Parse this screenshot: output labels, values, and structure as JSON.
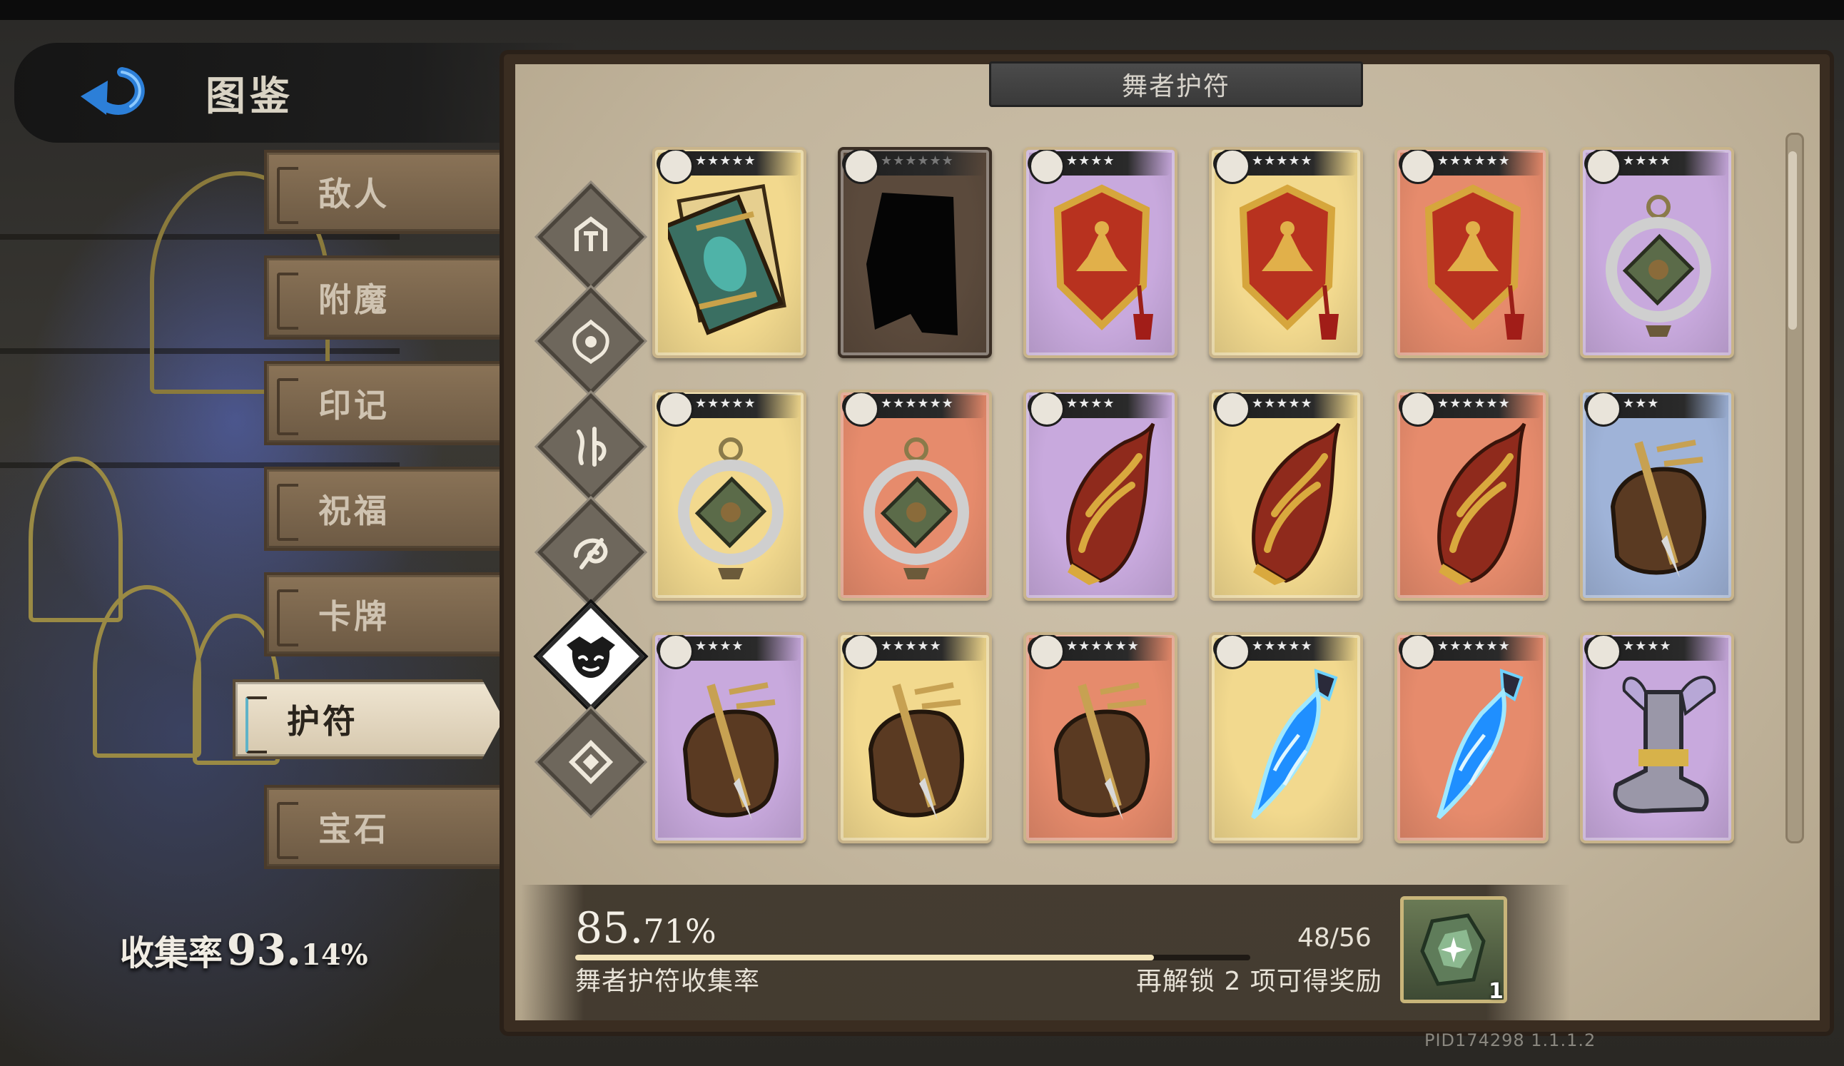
{
  "header": {
    "title": "图鉴",
    "back_icon": "back-arrow-icon"
  },
  "tabs": [
    {
      "label": "敌人",
      "active": false
    },
    {
      "label": "附魔",
      "active": false
    },
    {
      "label": "印记",
      "active": false
    },
    {
      "label": "祝福",
      "active": false
    },
    {
      "label": "卡牌",
      "active": false
    },
    {
      "label": "护符",
      "active": true
    },
    {
      "label": "宝石",
      "active": false
    }
  ],
  "collection": {
    "label": "收集率",
    "value_big": "93.",
    "value_small": "14%"
  },
  "panel": {
    "title": "舞者护符"
  },
  "categories": [
    {
      "icon": "warrior-helm-icon",
      "active": false
    },
    {
      "icon": "ornate-crest-icon",
      "active": false
    },
    {
      "icon": "rune-glyph-icon",
      "active": false
    },
    {
      "icon": "swirl-glyph-icon",
      "active": false
    },
    {
      "icon": "jester-mask-icon",
      "active": true
    },
    {
      "icon": "knot-emblem-icon",
      "active": false
    }
  ],
  "cards": [
    {
      "item": "spellbook",
      "bg": "#f2d98e",
      "stars": "★★★★★"
    },
    {
      "item": "unknown-silhouette",
      "bg": "#5b4a3c",
      "stars": "★★★★★★",
      "locked": true
    },
    {
      "item": "red-shield-charm",
      "bg": "#c8a9dd",
      "stars": "★★★★"
    },
    {
      "item": "red-shield-charm",
      "bg": "#f2d98e",
      "stars": "★★★★★"
    },
    {
      "item": "red-shield-charm",
      "bg": "#e68b6c",
      "stars": "★★★★★★"
    },
    {
      "item": "jade-ring-amulet",
      "bg": "#c8a9dd",
      "stars": "★★★★"
    },
    {
      "item": "jade-ring-amulet",
      "bg": "#f2d98e",
      "stars": "★★★★★"
    },
    {
      "item": "jade-ring-amulet",
      "bg": "#e68b6c",
      "stars": "★★★★★★"
    },
    {
      "item": "flame-bracer",
      "bg": "#c8a9dd",
      "stars": "★★★★"
    },
    {
      "item": "flame-bracer",
      "bg": "#f2d98e",
      "stars": "★★★★★"
    },
    {
      "item": "flame-bracer",
      "bg": "#e68b6c",
      "stars": "★★★★★★"
    },
    {
      "item": "dagger-quiver",
      "bg": "#9fb3d8",
      "stars": "★★★"
    },
    {
      "item": "dagger-quiver",
      "bg": "#c8a9dd",
      "stars": "★★★★"
    },
    {
      "item": "dagger-quiver",
      "bg": "#f2d98e",
      "stars": "★★★★★"
    },
    {
      "item": "dagger-quiver",
      "bg": "#e68b6c",
      "stars": "★★★★★★"
    },
    {
      "item": "azure-blade",
      "bg": "#f2d98e",
      "stars": "★★★★★"
    },
    {
      "item": "azure-blade",
      "bg": "#e68b6c",
      "stars": "★★★★★★"
    },
    {
      "item": "winged-boot",
      "bg": "#c8a9dd",
      "stars": "★★★★"
    }
  ],
  "progress": {
    "percent_big": "85.",
    "percent_small": "71%",
    "fraction": 0.8571,
    "count": "48/56",
    "label": "舞者护符收集率",
    "reward_text": "再解锁 2 项可得奖励",
    "reward_icon": "green-crystal-icon",
    "reward_qty": "1"
  },
  "footer": {
    "pid": "PID174298  1.1.1.2"
  }
}
